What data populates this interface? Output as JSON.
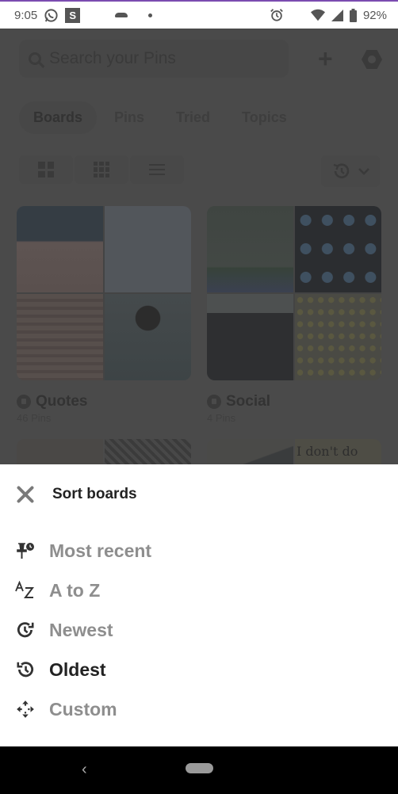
{
  "status_bar": {
    "time": "9:05",
    "notif_s": "S",
    "battery": "92%",
    "icons": [
      "whatsapp-icon",
      "s-app-icon",
      "mustache-icon",
      "dot-icon",
      "alarm-icon",
      "wifi-icon",
      "signal-icon",
      "battery-icon"
    ]
  },
  "header": {
    "search_placeholder": "Search your Pins",
    "add_icon": "plus-icon",
    "settings_icon": "settings-hex-icon"
  },
  "tabs": [
    {
      "label": "Boards",
      "active": true
    },
    {
      "label": "Pins",
      "active": false
    },
    {
      "label": "Tried",
      "active": false
    },
    {
      "label": "Topics",
      "active": false
    }
  ],
  "view_toggle": {
    "options": [
      "grid-large-icon",
      "grid-small-icon",
      "list-icon"
    ],
    "sort_icon": "history-icon",
    "sort_chevron": "chevron-down-icon"
  },
  "boards": [
    {
      "name": "Quotes",
      "count": "46 Pins",
      "secret": true
    },
    {
      "name": "Social",
      "count": "4 Pins",
      "secret": true
    }
  ],
  "peek_text": "I don't do",
  "sort_sheet": {
    "title": "Sort boards",
    "close_icon": "close-icon",
    "options": [
      {
        "label": "Most recent",
        "icon": "pin-clock-icon",
        "selected": false
      },
      {
        "label": "A to Z",
        "icon": "a-z-icon",
        "selected": false
      },
      {
        "label": "Newest",
        "icon": "clock-forward-icon",
        "selected": false
      },
      {
        "label": "Oldest",
        "icon": "history-icon",
        "selected": true
      },
      {
        "label": "Custom",
        "icon": "move-arrows-icon",
        "selected": false
      }
    ]
  },
  "nav_bar": {
    "back_label": "‹"
  }
}
